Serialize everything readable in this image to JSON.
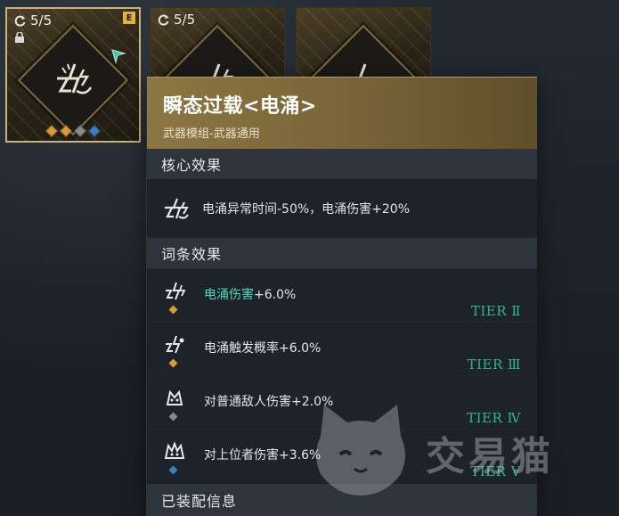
{
  "mod_cards": [
    {
      "count": "5/5",
      "grade": "E",
      "selected": true,
      "slot_colors": [
        "#d99a3c",
        "#d99a3c",
        "#8a8a8a",
        "#3e7cc4"
      ]
    },
    {
      "count": "5/5",
      "selected": false
    },
    {
      "count": "",
      "selected": false
    }
  ],
  "tooltip": {
    "title": "瞬态过载<电涌>",
    "subtitle": "武器模组-武器通用",
    "core_section_label": "核心效果",
    "core_effect_text": "电涌异常时间-50%，电涌伤害+20%",
    "substat_section_label": "词条效果",
    "substats": [
      {
        "highlight": "电涌伤害",
        "text": "+6.0%",
        "tier": "TIER Ⅱ",
        "dot_color": "#d99a3c"
      },
      {
        "highlight": "",
        "text": "电涌触发概率+6.0%",
        "tier": "TIER Ⅲ",
        "dot_color": "#d99a3c"
      },
      {
        "highlight": "",
        "text": "对普通敌人伤害+2.0%",
        "tier": "TIER Ⅳ",
        "dot_color": "#8a8a8a"
      },
      {
        "highlight": "",
        "text": "对上位者伤害+3.6%",
        "tier": "TIER Ⅴ",
        "dot_color": "#3e7cc4"
      }
    ],
    "equip_section_label": "已装配信息"
  },
  "watermark": {
    "text": "交易猫"
  },
  "colors": {
    "accent_gold": "#c7b37b",
    "tier_teal": "#2fb39f",
    "highlight_teal": "#4fd7c3"
  },
  "icons": [
    "sync-icon",
    "lock-icon",
    "lightning-emblem-icon",
    "arrow-corner-icon",
    "cat-logo-icon"
  ]
}
